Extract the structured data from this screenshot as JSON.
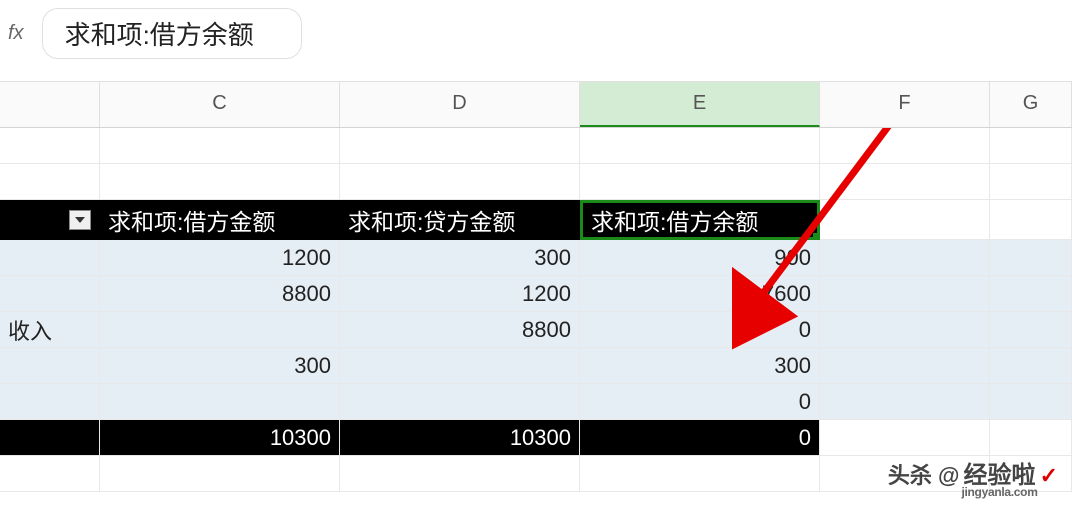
{
  "formula_bar": {
    "fx_label": "fx",
    "value": "求和项:借方余额"
  },
  "columns": {
    "b": "",
    "c": "C",
    "d": "D",
    "e": "E",
    "f": "F",
    "g": "G"
  },
  "selected_column": "E",
  "pivot": {
    "header": {
      "c": "求和项:借方金额",
      "d": "求和项:贷方金额",
      "e": "求和项:借方余额"
    },
    "rows": [
      {
        "b": "",
        "c": "1200",
        "d": "300",
        "e": "900"
      },
      {
        "b": "",
        "c": "8800",
        "d": "1200",
        "e": "7600"
      },
      {
        "b": "收入",
        "c": "",
        "d": "8800",
        "e": "0"
      },
      {
        "b": "",
        "c": "300",
        "d": "",
        "e": "300"
      },
      {
        "b": "",
        "c": "",
        "d": "",
        "e": "0"
      }
    ],
    "total": {
      "c": "10300",
      "d": "10300",
      "e": "0"
    }
  },
  "watermark": {
    "prefix": "头杀 @",
    "brand": "经验啦",
    "site": "jingyanla.com"
  }
}
